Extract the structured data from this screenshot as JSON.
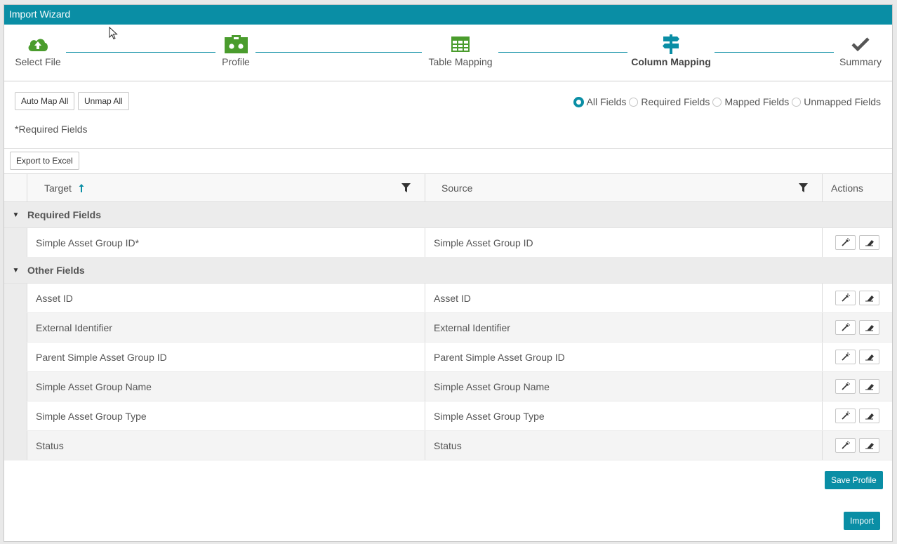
{
  "window": {
    "title": "Import Wizard"
  },
  "steps": [
    {
      "label": "Select File",
      "icon": "cloud-upload-icon",
      "color": "#4a9c2d"
    },
    {
      "label": "Profile",
      "icon": "profile-icon",
      "color": "#4a9c2d"
    },
    {
      "label": "Table Mapping",
      "icon": "table-icon",
      "color": "#4a9c2d"
    },
    {
      "label": "Column Mapping",
      "icon": "signpost-icon",
      "color": "#0a8ea5",
      "active": true
    },
    {
      "label": "Summary",
      "icon": "checkmark-icon",
      "color": "#555555"
    }
  ],
  "toolbar": {
    "auto_map_all": "Auto Map All",
    "unmap_all": "Unmap All",
    "export_excel": "Export to Excel"
  },
  "filters": {
    "options": [
      "All Fields",
      "Required Fields",
      "Mapped Fields",
      "Unmapped Fields"
    ],
    "selected": "All Fields"
  },
  "required_note": "*Required Fields",
  "grid": {
    "headers": {
      "target": "Target",
      "source": "Source",
      "actions": "Actions"
    },
    "sort": "ascending",
    "groups": [
      {
        "name": "Required Fields",
        "rows": [
          {
            "target": "Simple Asset Group ID*",
            "source": "Simple Asset Group ID"
          }
        ]
      },
      {
        "name": "Other Fields",
        "rows": [
          {
            "target": "Asset ID",
            "source": "Asset ID"
          },
          {
            "target": "External Identifier",
            "source": "External Identifier"
          },
          {
            "target": "Parent Simple Asset Group ID",
            "source": "Parent Simple Asset Group ID"
          },
          {
            "target": "Simple Asset Group Name",
            "source": "Simple Asset Group Name"
          },
          {
            "target": "Simple Asset Group Type",
            "source": "Simple Asset Group Type"
          },
          {
            "target": "Status",
            "source": "Status"
          }
        ]
      }
    ]
  },
  "footer": {
    "save_profile": "Save Profile",
    "import": "Import"
  },
  "colors": {
    "accent": "#0a8ea5",
    "green": "#4a9c2d"
  }
}
